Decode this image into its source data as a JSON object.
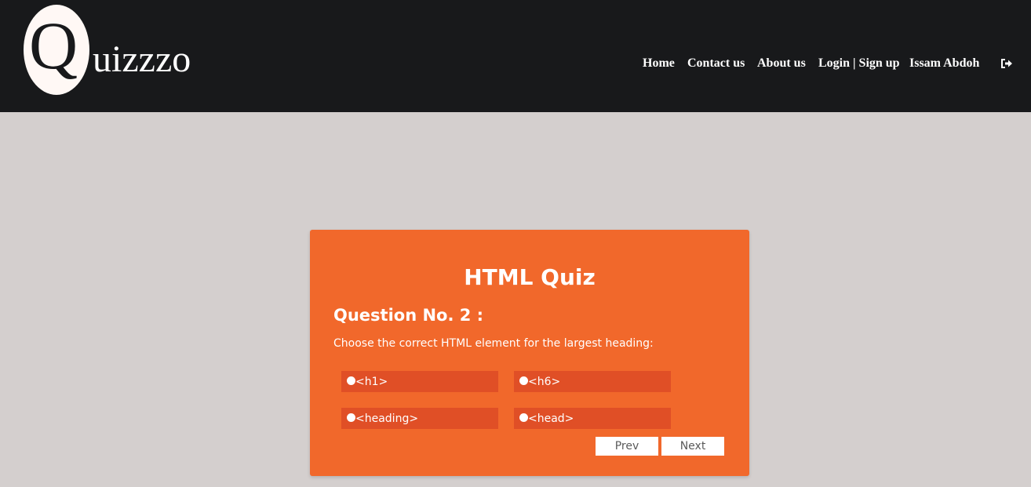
{
  "brand": {
    "logo_letter": "Q",
    "logo_rest": "uizzzo"
  },
  "nav": {
    "home": "Home",
    "contact": "Contact us",
    "about": "About us",
    "login": "Login | Sign up",
    "user": "Issam Abdoh",
    "signout_icon": "sign-out-icon"
  },
  "quiz": {
    "title": "HTML Quiz",
    "question_number": "Question No. 2 :",
    "question_text": "Choose the correct HTML element for the largest heading:",
    "options": [
      "<h1>",
      "<h6>",
      "<heading>",
      "<head>"
    ],
    "prev_label": "Prev",
    "next_label": "Next"
  },
  "colors": {
    "navbar": "#18191b",
    "page_background": "#d4cfce",
    "card": "#f1682b",
    "option": "#e04f26",
    "text": "#ffffff"
  }
}
